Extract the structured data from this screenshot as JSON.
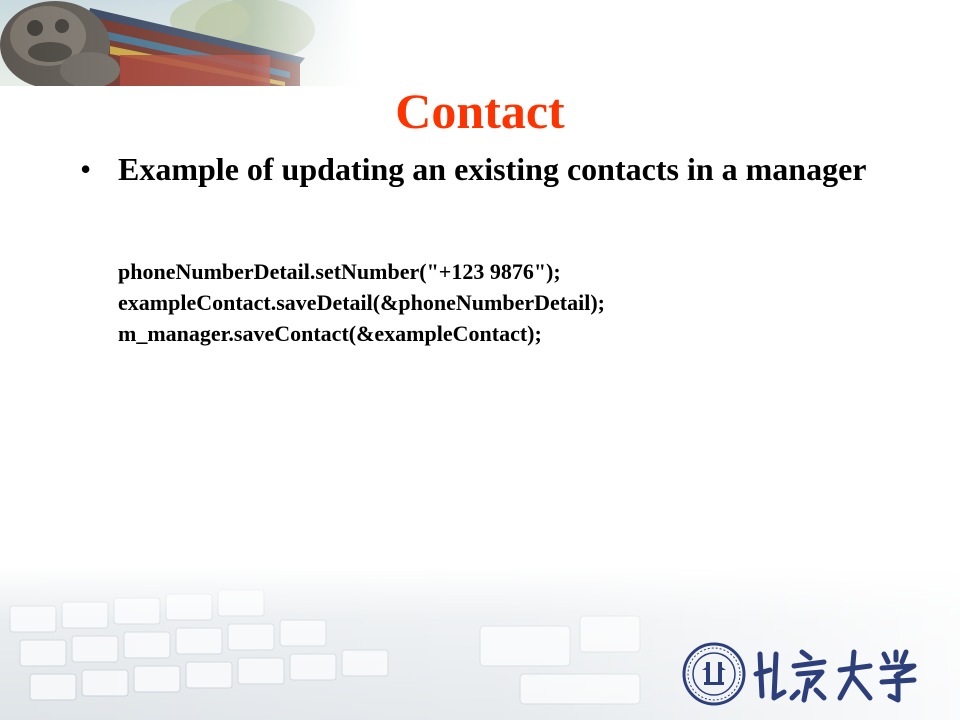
{
  "slide": {
    "title": "Contact",
    "bullet_symbol": "•",
    "bullet_text": "Example of updating an existing contacts in a manager",
    "code_lines": [
      "phoneNumberDetail.setNumber(\"+123 9876\");",
      "exampleContact.saveDetail(&phoneNumberDetail);",
      "m_manager.saveContact(&exampleContact);"
    ]
  },
  "decor": {
    "title_color": "#ff3300",
    "top_banner": "palace-rooftop-lion-photo",
    "bottom_band": "keyboard-photo-faded",
    "logo": "peking-university-logo"
  }
}
